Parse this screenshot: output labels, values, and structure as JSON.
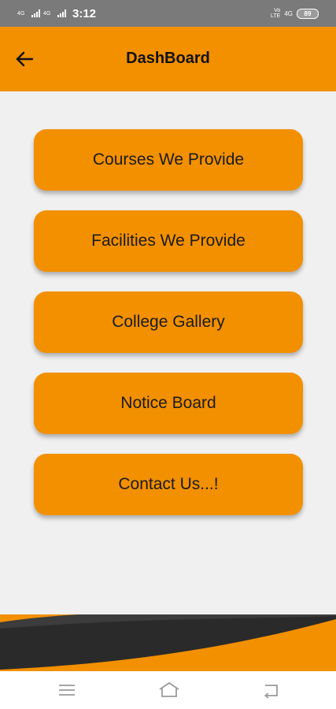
{
  "status_bar": {
    "network_left_1": "4G",
    "network_left_2": "4G",
    "time": "3:12",
    "volte": "Vo LTE",
    "network_right": "4G",
    "battery": "89"
  },
  "app_bar": {
    "title": "DashBoard",
    "back_icon": "arrow-left-icon"
  },
  "menu": {
    "items": [
      {
        "label": "Courses We Provide"
      },
      {
        "label": "Facilities We Provide"
      },
      {
        "label": "College Gallery"
      },
      {
        "label": "Notice Board"
      },
      {
        "label": "Contact Us...!"
      }
    ]
  },
  "nav_bar": {
    "menu_icon": "menu-lines-icon",
    "home_icon": "home-icon",
    "back_icon": "back-return-icon"
  },
  "colors": {
    "accent": "#f29000",
    "background": "#f0f0f0",
    "status_bar": "#7a7a7a",
    "footer_dark": "#2a2a2a"
  }
}
